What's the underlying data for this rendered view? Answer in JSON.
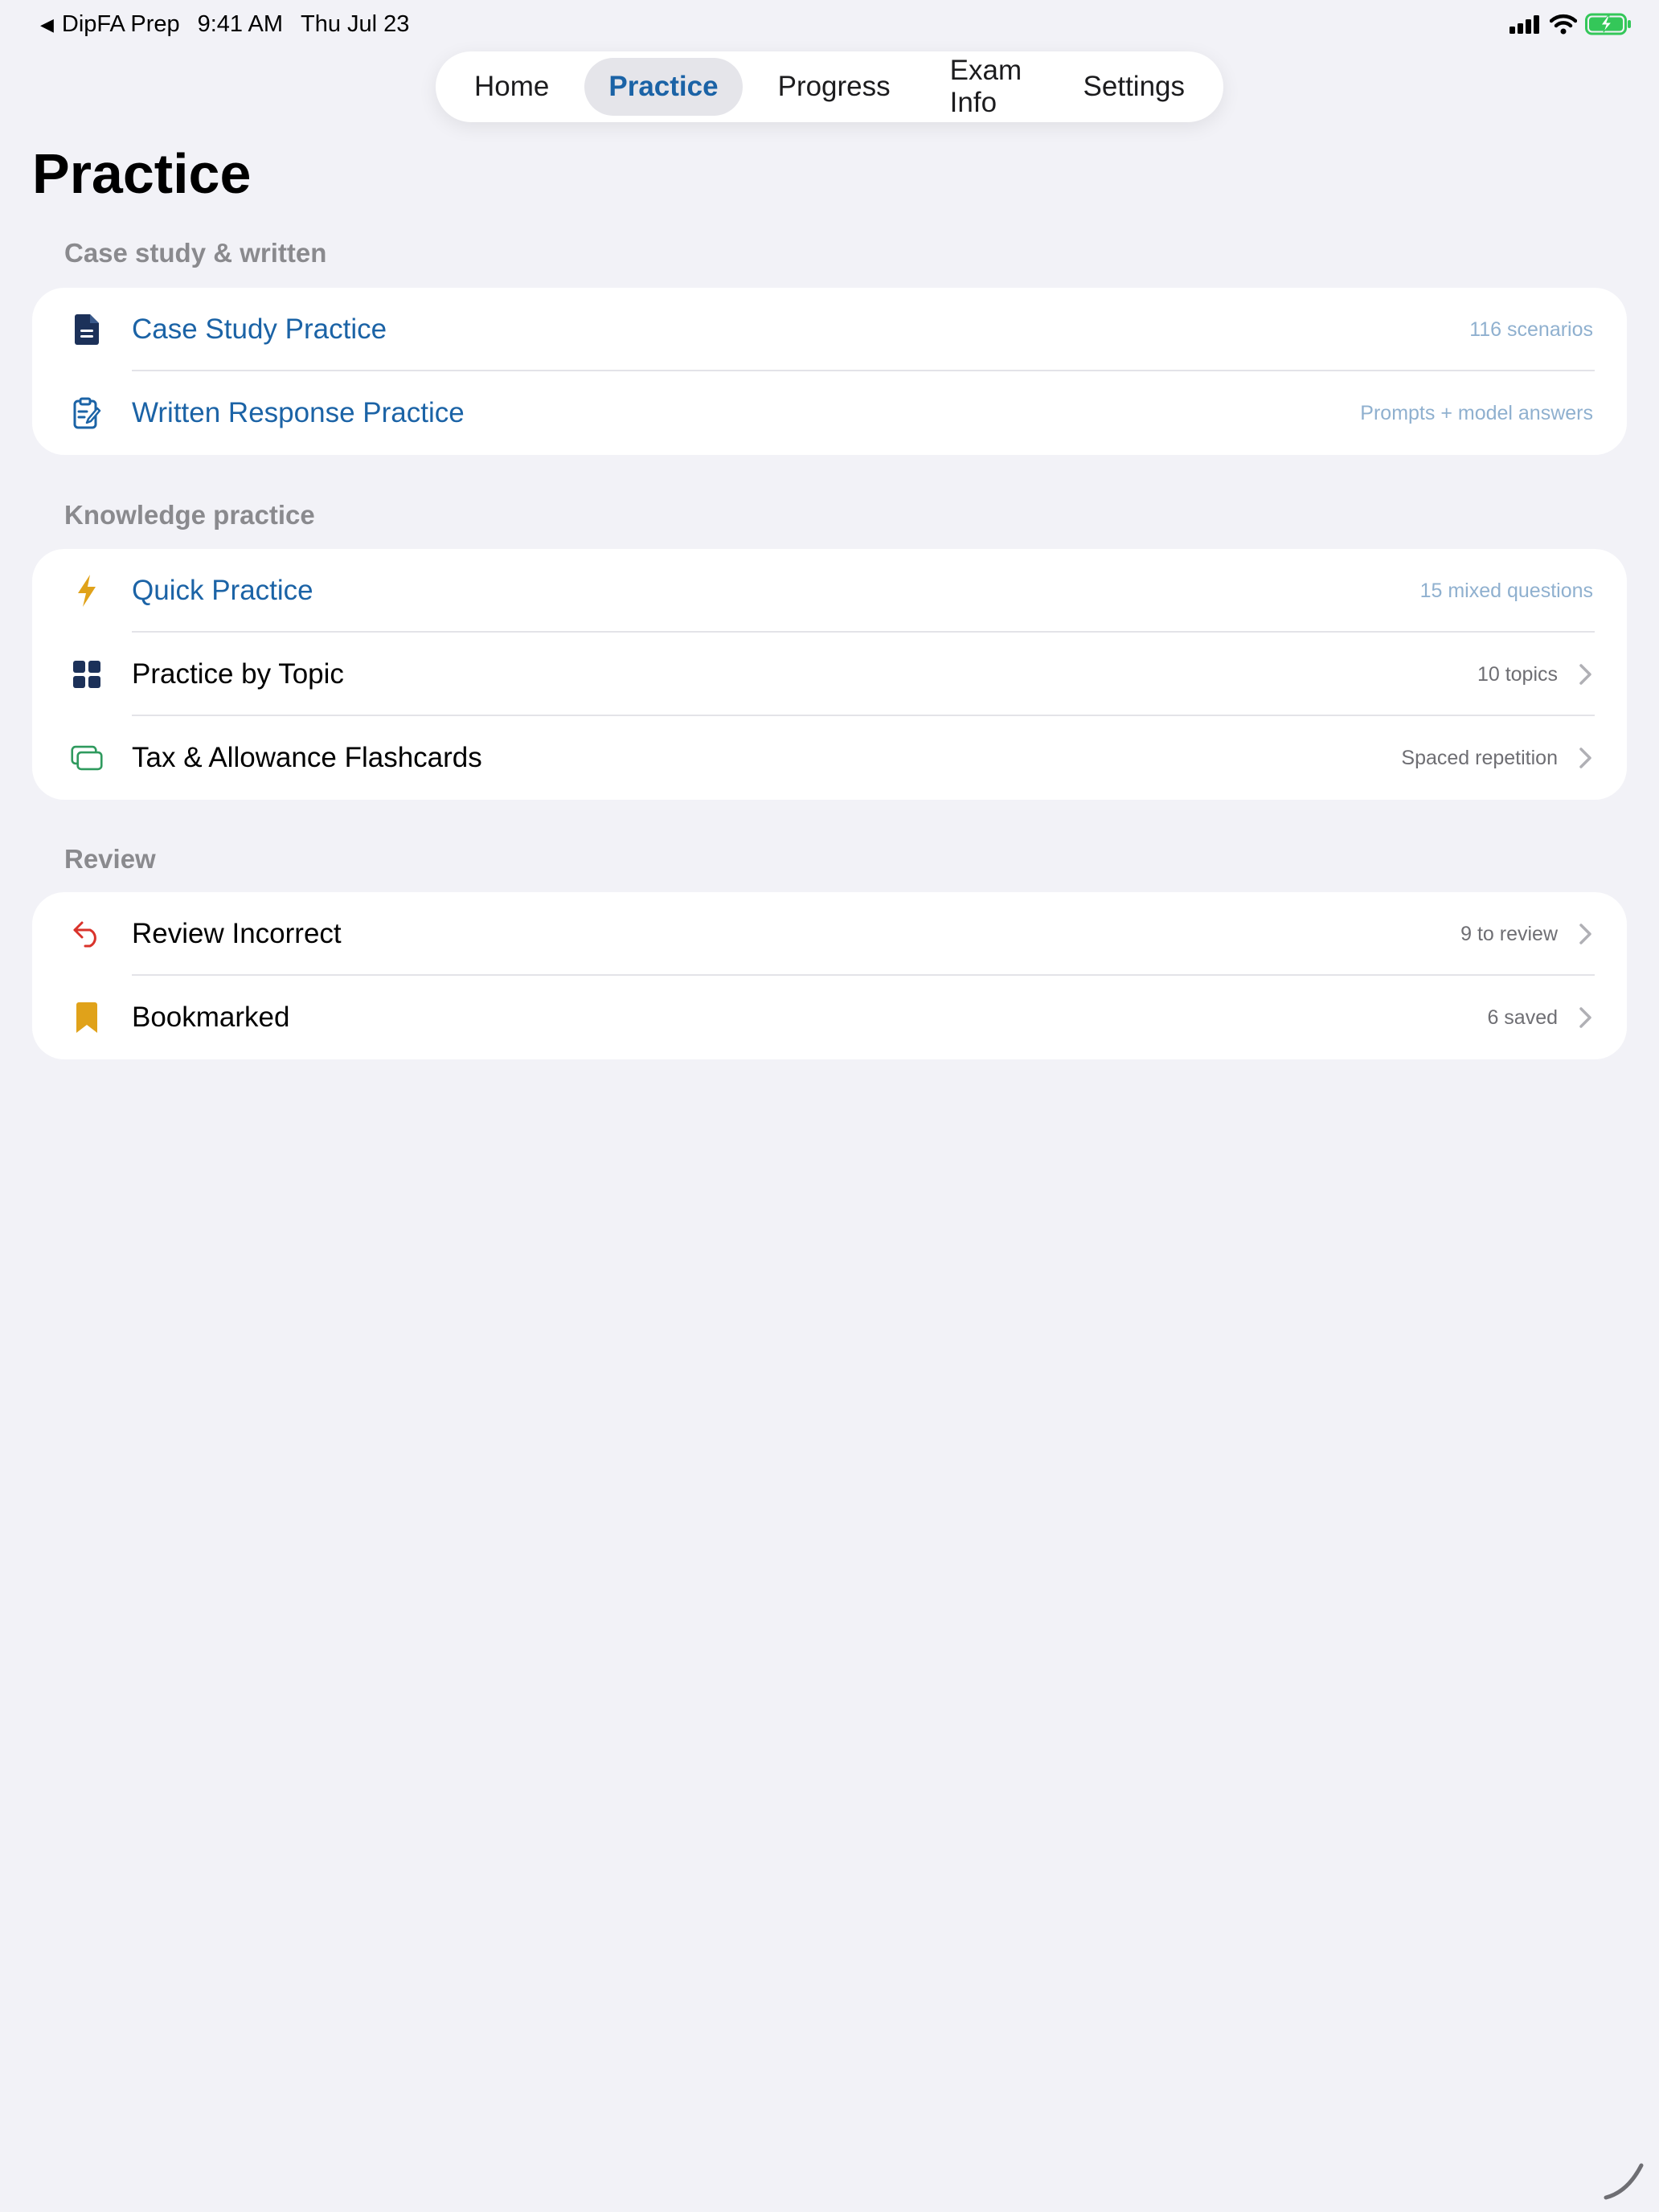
{
  "status_bar": {
    "back_app": "DipFA Prep",
    "time": "9:41 AM",
    "date": "Thu Jul 23"
  },
  "nav": {
    "tabs": [
      {
        "label": "Home",
        "active": false
      },
      {
        "label": "Practice",
        "active": true
      },
      {
        "label": "Progress",
        "active": false
      },
      {
        "label": "Exam Info",
        "active": false
      },
      {
        "label": "Settings",
        "active": false
      }
    ]
  },
  "page": {
    "title": "Practice"
  },
  "sections": [
    {
      "header": "Case study & written",
      "rows": [
        {
          "icon": "document-icon",
          "label": "Case Study Practice",
          "detail": "116 scenarios"
        },
        {
          "icon": "clipboard-edit-icon",
          "label": "Written Response Practice",
          "detail": "Prompts + model answers"
        }
      ]
    },
    {
      "header": "Knowledge practice",
      "rows": [
        {
          "icon": "bolt-icon",
          "label": "Quick Practice",
          "detail": "15 mixed questions"
        },
        {
          "icon": "grid-icon",
          "label": "Practice by Topic",
          "detail": "10 topics"
        },
        {
          "icon": "cards-icon",
          "label": "Tax & Allowance Flashcards",
          "detail": "Spaced repetition"
        }
      ]
    },
    {
      "header": "Review",
      "rows": [
        {
          "icon": "undo-arrow-icon",
          "label": "Review Incorrect",
          "detail": "9 to review"
        },
        {
          "icon": "bookmark-icon",
          "label": "Bookmarked",
          "detail": "6 saved"
        }
      ]
    }
  ],
  "colors": {
    "accent": "#1b63a6",
    "background": "#f2f2f7",
    "bolt": "#e0a21a",
    "bookmark": "#e0a21a",
    "undo": "#d9332b",
    "cards": "#2f9a5e",
    "navy": "#1c3159"
  }
}
